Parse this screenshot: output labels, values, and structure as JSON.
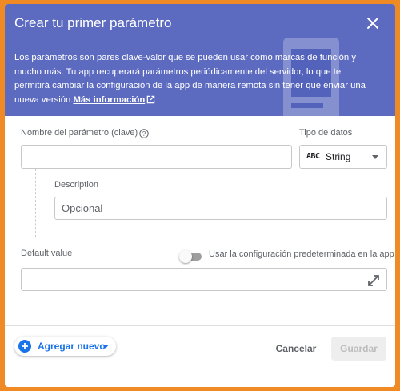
{
  "dialog": {
    "title": "Crear tu primer parámetro",
    "description": "Los parámetros son pares clave-valor que se pueden usar como marcas de función y mucho más. Tu app recuperará parámetros periódicamente del servidor, lo que te permitirá cambiar la configuración de la app de manera remota sin tener que enviar una nueva versión.",
    "learn_more_link": "Más información"
  },
  "form": {
    "param_name_label": "Nombre del parámetro (clave)",
    "param_name_value": "",
    "data_type_label": "Tipo de datos",
    "data_type_icon": "ABC",
    "data_type_value": "String",
    "description_label": "Description",
    "description_placeholder": "Opcional",
    "default_value_label": "Default value",
    "use_default_toggle_label": "Usar la configuración predeterminada en la app",
    "default_value": ""
  },
  "footer": {
    "add_new_label": "Agregar nuevo",
    "cancel_label": "Cancelar",
    "save_label": "Guardar"
  },
  "colors": {
    "header_bg": "#5c6bc0",
    "frame_border": "#f08a24",
    "accent": "#1a73e8"
  }
}
